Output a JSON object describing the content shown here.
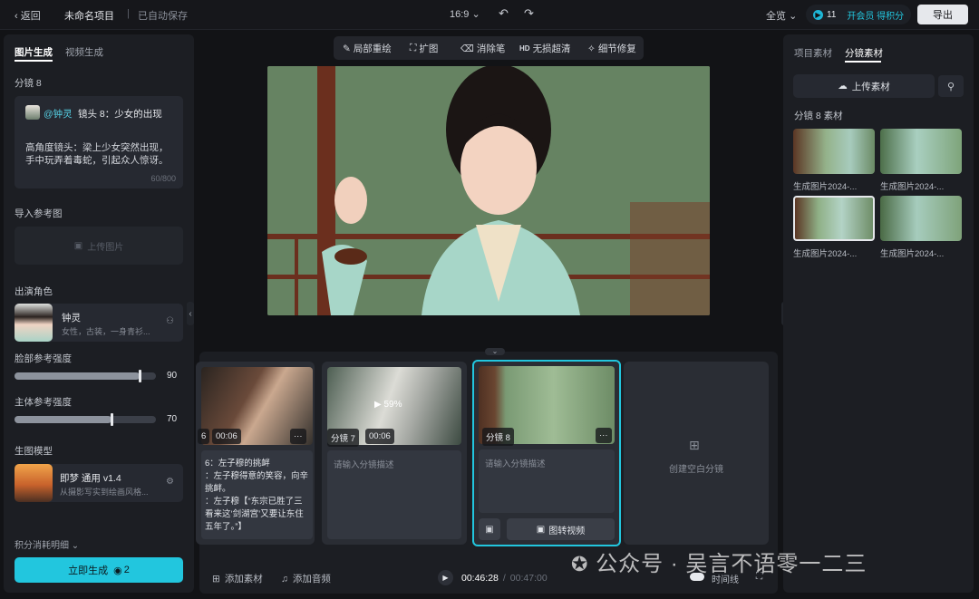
{
  "topbar": {
    "back_label": "返回",
    "project_name": "未命名项目",
    "autosave": "已自动保存",
    "ratio": "16:9",
    "view": "全览",
    "credits": "11",
    "member_label": "开会员 得积分",
    "export_label": "导出"
  },
  "left": {
    "tabs": [
      "图片生成",
      "视频生成"
    ],
    "shot_title": "分镜 8",
    "prompt_mention": "@钟灵",
    "prompt_head": "镜头 8：少女的出现",
    "prompt_body": "高角度镜头：梁上少女突然出现，手中玩弄着毒蛇，引起众人惊讶。",
    "char_count": "60/800",
    "ref_label": "导入参考图",
    "upload_image": "上传图片",
    "cast_label": "出演角色",
    "character_name": "钟灵",
    "character_desc": "女性，古装，一身青衫...",
    "face_strength_label": "脸部参考强度",
    "face_strength": 90,
    "body_strength_label": "主体参考强度",
    "body_strength": 70,
    "model_label": "生图模型",
    "model_name": "即梦 通用 v1.4",
    "model_desc": "从摄影写实到绘画风格...",
    "cost_label": "积分消耗明细",
    "generate_label": "立即生成",
    "generate_cost": "2"
  },
  "toolbar": {
    "items": [
      "局部重绘",
      "扩图",
      "消除笔",
      "无损超清",
      "细节修复"
    ],
    "hd_badge": "HD"
  },
  "story": {
    "shots": [
      {
        "label": "6",
        "duration": "00:06",
        "text": "6：左子穆的挑衅\n：左子穆得意的笑容，向辛挑衅。\n：左子穆【“东宗已胜了三看来这‘剑湖宫’又要让东住五年了。”】"
      },
      {
        "label": "分镜 7",
        "duration": "00:06",
        "progress": "59%",
        "placeholder": "请输入分镜描述"
      },
      {
        "label": "分镜 8",
        "placeholder": "请输入分镜描述",
        "to_video": "图转视频"
      }
    ],
    "empty_label": "创建空白分镜",
    "add_material": "添加素材",
    "add_audio": "添加音频",
    "time_current": "00:46:28",
    "time_total": "00:47:00",
    "timeline_label": "时间线"
  },
  "right": {
    "tabs": [
      "项目素材",
      "分镜素材"
    ],
    "upload_label": "上传素材",
    "group_label": "分镜 8 素材",
    "thumb_caption": "生成图片2024-..."
  },
  "watermark": "公众号 · 吴言不语零一二三",
  "colors": {
    "accent": "#22c6de",
    "bg": "#121316",
    "panel": "#1c1e23"
  }
}
